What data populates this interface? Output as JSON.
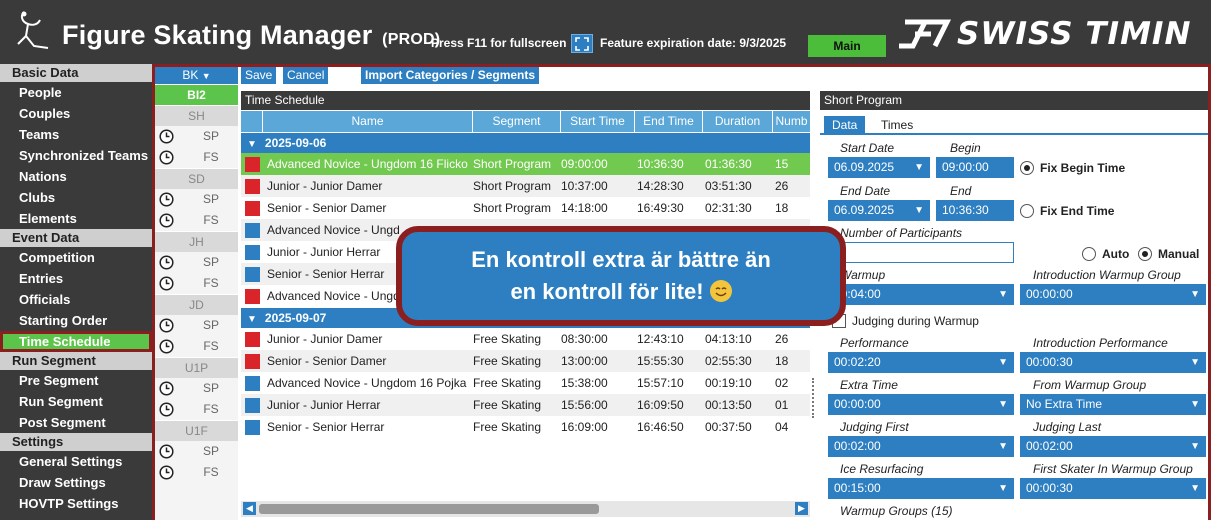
{
  "header": {
    "title": "Figure Skating Manager",
    "env": "(PROD)",
    "fullscreen_hint": "Press F11 for fullscreen",
    "expiry": "Feature expiration date: 9/3/2025",
    "main_button": "Main",
    "brand": "SWISS TIMIN"
  },
  "nav": {
    "sections": [
      {
        "title": "Basic Data",
        "items": [
          "People",
          "Couples",
          "Teams",
          "Synchronized Teams",
          "Nations",
          "Clubs",
          "Elements"
        ]
      },
      {
        "title": "Event Data",
        "items": [
          "Competition",
          "Entries",
          "Officials",
          "Starting Order",
          "Time Schedule"
        ]
      },
      {
        "title": "Run Segment",
        "items": [
          "Pre Segment",
          "Run Segment",
          "Post Segment"
        ]
      },
      {
        "title": "Settings",
        "items": [
          "General Settings",
          "Draw Settings",
          "HOVTP Settings"
        ]
      }
    ],
    "active": "Time Schedule"
  },
  "groups": {
    "selector": "BK",
    "levels": [
      {
        "name": "BI2",
        "segments": []
      },
      {
        "name": "SH",
        "segments": [
          "SP",
          "FS"
        ]
      },
      {
        "name": "SD",
        "segments": [
          "SP",
          "FS"
        ]
      },
      {
        "name": "JH",
        "segments": [
          "SP",
          "FS"
        ]
      },
      {
        "name": "JD",
        "segments": [
          "SP",
          "FS"
        ]
      },
      {
        "name": "U1P",
        "segments": [
          "SP",
          "FS"
        ]
      },
      {
        "name": "U1F",
        "segments": [
          "SP",
          "FS"
        ]
      }
    ]
  },
  "toolbar": {
    "save": "Save",
    "cancel": "Cancel",
    "import": "Import Categories / Segments"
  },
  "schedule": {
    "title": "Time Schedule",
    "columns": [
      "Name",
      "Segment",
      "Start Time",
      "End Time",
      "Duration",
      "Numb"
    ],
    "days": [
      {
        "date": "2025-09-06",
        "rows": [
          {
            "color": "#d9252a",
            "name": "Advanced Novice - Ungdom 16 Flicko",
            "segment": "Short Program",
            "start": "09:00:00",
            "end": "10:36:30",
            "duration": "01:36:30",
            "num": "15",
            "selected": true
          },
          {
            "color": "#d9252a",
            "name": "Junior - Junior Damer",
            "segment": "Short Program",
            "start": "10:37:00",
            "end": "14:28:30",
            "duration": "03:51:30",
            "num": "26"
          },
          {
            "color": "#d9252a",
            "name": "Senior - Senior Damer",
            "segment": "Short Program",
            "start": "14:18:00",
            "end": "16:49:30",
            "duration": "02:31:30",
            "num": "18"
          },
          {
            "color": "#2d7fc1",
            "name": "Advanced Novice - Ungd",
            "segment": "",
            "start": "",
            "end": "",
            "duration": "",
            "num": ""
          },
          {
            "color": "#2d7fc1",
            "name": "Junior - Junior Herrar",
            "segment": "",
            "start": "",
            "end": "",
            "duration": "",
            "num": ""
          },
          {
            "color": "#2d7fc1",
            "name": "Senior - Senior Herrar",
            "segment": "",
            "start": "",
            "end": "",
            "duration": "",
            "num": ""
          },
          {
            "color": "#d9252a",
            "name": "Advanced Novice - Ungd",
            "segment": "",
            "start": "",
            "end": "",
            "duration": "",
            "num": ""
          }
        ]
      },
      {
        "date": "2025-09-07",
        "rows": [
          {
            "color": "#d9252a",
            "name": "Junior - Junior Damer",
            "segment": "Free Skating",
            "start": "08:30:00",
            "end": "12:43:10",
            "duration": "04:13:10",
            "num": "26"
          },
          {
            "color": "#d9252a",
            "name": "Senior - Senior Damer",
            "segment": "Free Skating",
            "start": "13:00:00",
            "end": "15:55:30",
            "duration": "02:55:30",
            "num": "18"
          },
          {
            "color": "#2d7fc1",
            "name": "Advanced Novice - Ungdom 16 Pojka",
            "segment": "Free Skating",
            "start": "15:38:00",
            "end": "15:57:10",
            "duration": "00:19:10",
            "num": "02"
          },
          {
            "color": "#2d7fc1",
            "name": "Junior - Junior Herrar",
            "segment": "Free Skating",
            "start": "15:56:00",
            "end": "16:09:50",
            "duration": "00:13:50",
            "num": "01"
          },
          {
            "color": "#2d7fc1",
            "name": "Senior - Senior Herrar",
            "segment": "Free Skating",
            "start": "16:09:00",
            "end": "16:46:50",
            "duration": "00:37:50",
            "num": "04"
          }
        ]
      }
    ]
  },
  "short_program": {
    "title": "Short Program",
    "tabs": [
      "Data",
      "Times"
    ],
    "start_date_label": "Start Date",
    "begin_label": "Begin",
    "start_date": "06.09.2025",
    "begin": "09:00:00",
    "fix_begin": "Fix Begin Time",
    "end_date_label": "End Date",
    "end_label": "End",
    "end_date": "06.09.2025",
    "end": "10:36:30",
    "fix_end": "Fix End Time",
    "participants_label": "Number of Participants",
    "auto": "Auto",
    "manual": "Manual",
    "warmup_label": "Warmup",
    "warmup": "00:04:00",
    "intro_warmup_label": "Introduction Warmup Group",
    "intro_warmup": "00:00:00",
    "judging_warmup": "Judging during Warmup",
    "performance_label": "Performance",
    "performance": "00:02:20",
    "intro_perf_label": "Introduction Performance",
    "intro_perf": "00:00:30",
    "extra_time_label": "Extra Time",
    "extra_time": "00:00:00",
    "from_warmup_label": "From Warmup Group",
    "from_warmup": "No Extra Time",
    "judging_first_label": "Judging First",
    "judging_first": "00:02:00",
    "judging_last_label": "Judging Last",
    "judging_last": "00:02:00",
    "ice_label": "Ice Resurfacing",
    "ice": "00:15:00",
    "first_skater_label": "First Skater In Warmup Group",
    "first_skater": "00:00:30",
    "warmup_groups_label": "Warmup Groups (15)"
  },
  "callout": {
    "line1": "En kontroll extra är bättre än",
    "line2": "en kontroll för lite!"
  },
  "colors": {
    "accent": "#2d7fc1",
    "active": "#5cc44a",
    "frame": "#8b1e1e",
    "dark": "#3a3a3a"
  }
}
